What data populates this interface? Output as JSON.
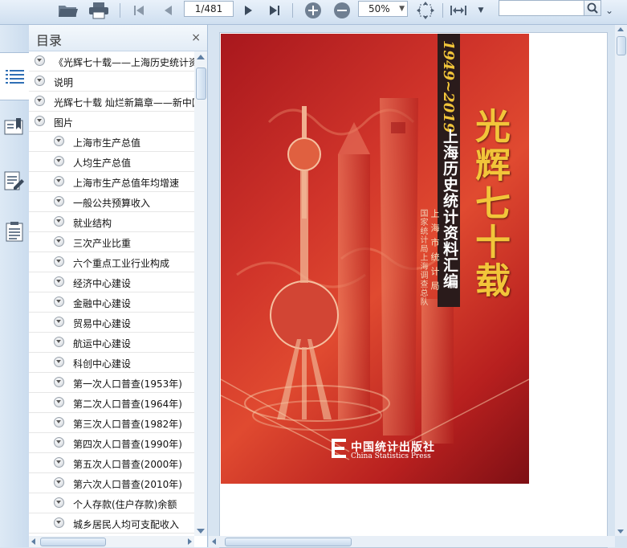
{
  "toolbar": {
    "current_page": "1/481",
    "zoom": "50%",
    "search_placeholder": ""
  },
  "panel": {
    "title": "目录",
    "close_label": "×"
  },
  "outline": [
    {
      "label": "《光辉七十载——上海历史统计资料汇编》",
      "level": 0
    },
    {
      "label": "说明",
      "level": 0
    },
    {
      "label": "光辉七十载 灿烂新篇章——新中国成立七十周年",
      "level": 0
    },
    {
      "label": "图片",
      "level": 0
    },
    {
      "label": "上海市生产总值",
      "level": 1
    },
    {
      "label": "人均生产总值",
      "level": 1
    },
    {
      "label": "上海市生产总值年均增速",
      "level": 1
    },
    {
      "label": "一般公共预算收入",
      "level": 1
    },
    {
      "label": "就业结构",
      "level": 1
    },
    {
      "label": "三次产业比重",
      "level": 1
    },
    {
      "label": "六个重点工业行业构成",
      "level": 1
    },
    {
      "label": "经济中心建设",
      "level": 1
    },
    {
      "label": "金融中心建设",
      "level": 1
    },
    {
      "label": "贸易中心建设",
      "level": 1
    },
    {
      "label": "航运中心建设",
      "level": 1
    },
    {
      "label": "科创中心建设",
      "level": 1
    },
    {
      "label": "第一次人口普查(1953年)",
      "level": 1
    },
    {
      "label": "第二次人口普查(1964年)",
      "level": 1
    },
    {
      "label": "第三次人口普查(1982年)",
      "level": 1
    },
    {
      "label": "第四次人口普查(1990年)",
      "level": 1
    },
    {
      "label": "第五次人口普查(2000年)",
      "level": 1
    },
    {
      "label": "第六次人口普查(2010年)",
      "level": 1
    },
    {
      "label": "个人存款(住户存款)余额",
      "level": 1
    },
    {
      "label": "城乡居民人均可支配收入",
      "level": 1
    }
  ],
  "cover": {
    "title": "光辉七十载",
    "years": "1949~2019",
    "subtitle": "上海历史统计资料汇编",
    "author1": "上海市统计局",
    "author2": "国家统计局上海调查总队",
    "publisher_cn": "中国统计出版社",
    "publisher_en": "China Statistics Press"
  }
}
